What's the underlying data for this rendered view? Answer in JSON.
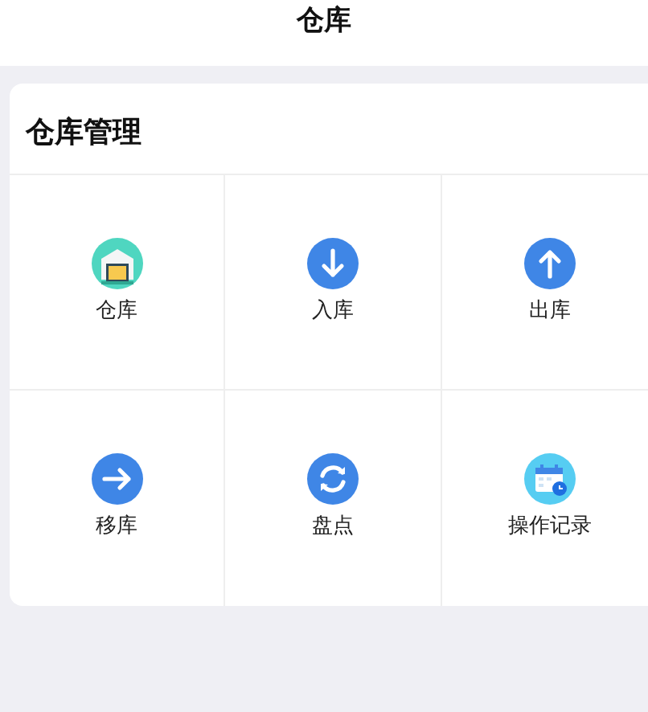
{
  "header": {
    "title": "仓库"
  },
  "section": {
    "title": "仓库管理"
  },
  "items": [
    {
      "label": "仓库",
      "kind": "warehouse"
    },
    {
      "label": "入库",
      "kind": "down"
    },
    {
      "label": "出库",
      "kind": "up"
    },
    {
      "label": "移库",
      "kind": "right"
    },
    {
      "label": "盘点",
      "kind": "refresh"
    },
    {
      "label": "操作记录",
      "kind": "calendar"
    }
  ]
}
